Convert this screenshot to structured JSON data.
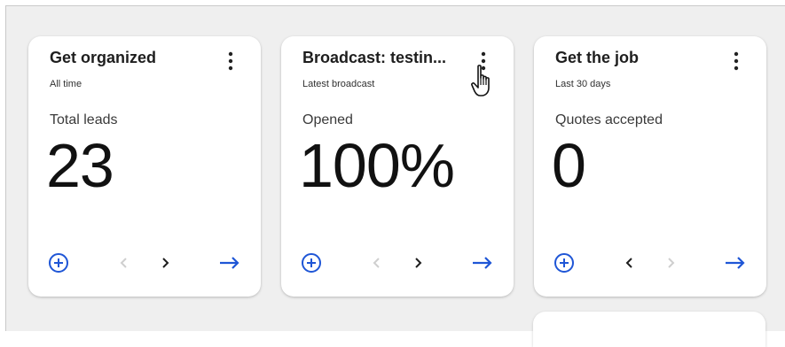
{
  "cards": [
    {
      "title": "Get organized",
      "subtitle": "All time",
      "metric_label": "Total leads",
      "metric_value": "23"
    },
    {
      "title": "Broadcast: testin...",
      "subtitle": "Latest broadcast",
      "metric_label": "Opened",
      "metric_value": "100%"
    },
    {
      "title": "Get the job",
      "subtitle": "Last 30 days",
      "metric_label": "Quotes accepted",
      "metric_value": "0"
    }
  ],
  "colors": {
    "accent": "#1f56d6",
    "nav_active": "#1e1e1e",
    "nav_disabled": "#cfcfcf",
    "background": "#efefef"
  },
  "icons": {
    "menu": "kebab-menu-icon",
    "add": "add-circle-icon",
    "prev": "chevron-left-icon",
    "next": "chevron-right-icon",
    "go": "arrow-right-icon",
    "cursor": "hand-pointer-cursor"
  }
}
